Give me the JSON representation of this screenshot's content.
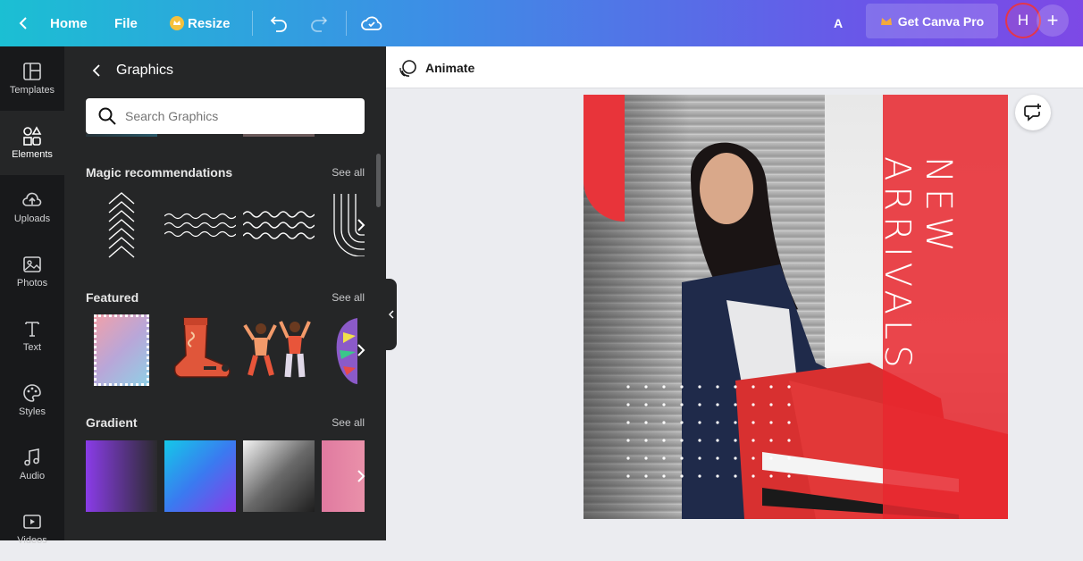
{
  "topbar": {
    "home": "Home",
    "file": "File",
    "resize": "Resize",
    "letter": "A",
    "pro_button": "Get Canva Pro",
    "avatar_initial": "H",
    "plus": "+"
  },
  "rail": {
    "items": [
      {
        "label": "Templates",
        "icon": "templates-icon"
      },
      {
        "label": "Elements",
        "icon": "elements-icon"
      },
      {
        "label": "Uploads",
        "icon": "uploads-icon"
      },
      {
        "label": "Photos",
        "icon": "photos-icon"
      },
      {
        "label": "Text",
        "icon": "text-icon"
      },
      {
        "label": "Styles",
        "icon": "styles-icon"
      },
      {
        "label": "Audio",
        "icon": "audio-icon"
      },
      {
        "label": "Videos",
        "icon": "videos-icon"
      }
    ]
  },
  "panel": {
    "title": "Graphics",
    "search_placeholder": "Search Graphics",
    "sections": [
      {
        "title": "Magic recommendations",
        "see_all": "See all"
      },
      {
        "title": "Featured",
        "see_all": "See all"
      },
      {
        "title": "Gradient",
        "see_all": "See all"
      }
    ]
  },
  "canvas": {
    "animate": "Animate",
    "design_text": "NEW ARRIVALS"
  },
  "colors": {
    "accent_red": "#e8343a",
    "panel_bg": "#252627",
    "rail_bg": "#18191b"
  }
}
